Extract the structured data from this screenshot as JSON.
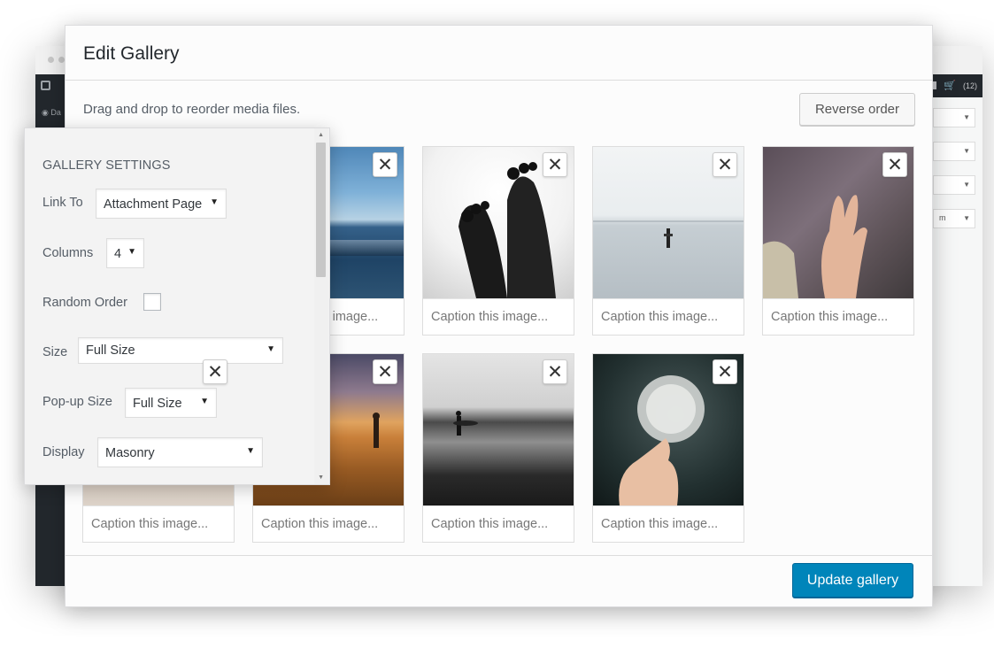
{
  "background_window": {
    "admin_menu_item": "Da",
    "cart_count": "(12)",
    "right_panel_option": "m"
  },
  "modal": {
    "title": "Edit Gallery",
    "instructions": "Drag and drop to reorder media files.",
    "reverse_order_label": "Reverse order",
    "update_gallery_label": "Update gallery",
    "remove_icon_glyph": "✕"
  },
  "gallery": {
    "caption_placeholder": "Caption this image...",
    "images": [
      {
        "subject": "ocean",
        "caption": "Caption this image..."
      },
      {
        "subject": "feet",
        "caption": "Caption this image..."
      },
      {
        "subject": "lake",
        "caption": "Caption this image..."
      },
      {
        "subject": "rainy-window-hand",
        "caption": "Caption this image..."
      },
      {
        "subject": "portrait",
        "caption": "Caption this image..."
      },
      {
        "subject": "field-sunset",
        "caption": "Caption this image..."
      },
      {
        "subject": "beach-surfer",
        "caption": "Caption this image..."
      },
      {
        "subject": "dandelion",
        "caption": "Caption this image..."
      }
    ]
  },
  "settings": {
    "heading": "GALLERY SETTINGS",
    "link_to_label": "Link To",
    "link_to_value": "Attachment Page",
    "columns_label": "Columns",
    "columns_value": "4",
    "random_order_label": "Random Order",
    "random_order_checked": false,
    "size_label": "Size",
    "size_value": "Full Size",
    "popup_size_label": "Pop-up Size",
    "popup_size_value": "Full Size",
    "display_label": "Display",
    "display_value": "Masonry"
  },
  "colors": {
    "primary_button": "#0085ba",
    "admin_bar": "#23282d"
  }
}
